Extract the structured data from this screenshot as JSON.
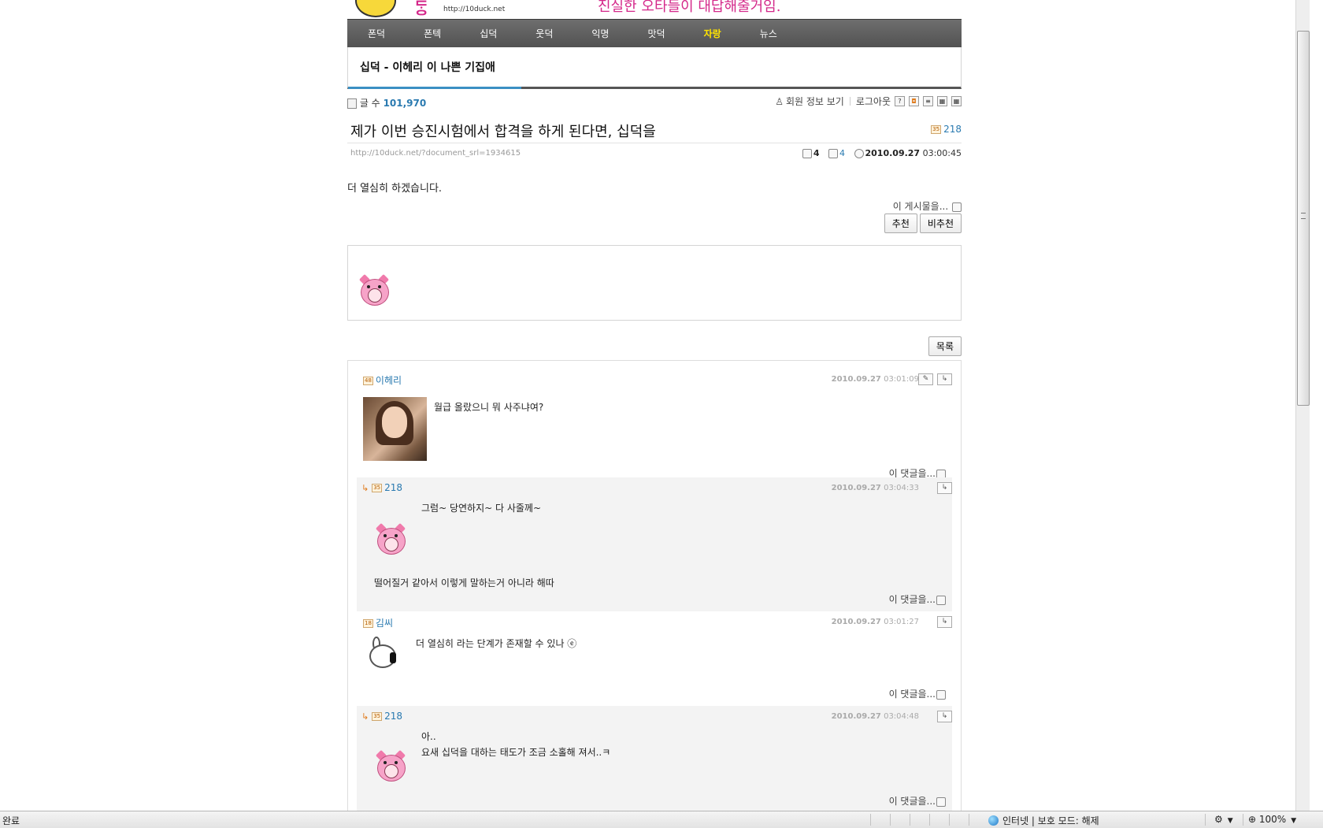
{
  "header": {
    "logo_fragment": "ᄃᆞᆼ",
    "logo_url": "http://10duck.net",
    "slogan": "진실한 오타들이 대답해줄거임."
  },
  "nav": [
    "폰덕",
    "폰텍",
    "십덕",
    "웃덕",
    "익명",
    "맛덕",
    "자랑",
    "뉴스"
  ],
  "nav_active_index": 6,
  "board_title": "십덕 - 이헤리 이 나쁜 기집애",
  "info": {
    "count_label": "글 수",
    "count_value": "101,970",
    "member_info": "회원 정보 보기",
    "logout": "로그아웃"
  },
  "document": {
    "title": "제가 이번 승진시험에서 합격을 하게 된다면, 십덕을",
    "author": "218",
    "url": "http://10duck.net/?document_srl=1934615",
    "comment_count": "4",
    "read_count": "4",
    "date": "2010.09.27",
    "time": "03:00:45",
    "content": "더 열심히 하겠습니다.",
    "this_post": "이 게시물을...",
    "recommend": "추천",
    "not_recommend": "비추천",
    "list_button": "목록"
  },
  "comments": [
    {
      "author": "이헤리",
      "date": "2010.09.27",
      "time": "03:01:09",
      "lines": [
        "월급 올랐으니 뭐 사주냐여?"
      ],
      "more": "이 댓글을..."
    },
    {
      "author": "218",
      "date": "2010.09.27",
      "time": "03:04:33",
      "lines": [
        "그럼~ 당연하지~ 다 사줄께~",
        "떨어질거 같아서 이렇게 말하는거 아니라 해따"
      ],
      "more": "이 댓글을..."
    },
    {
      "author": "김씨",
      "date": "2010.09.27",
      "time": "03:01:27",
      "lines": [
        "더 열심히 라는 단계가 존재할 수 있나 ⓔ"
      ],
      "more": "이 댓글을..."
    },
    {
      "author": "218",
      "date": "2010.09.27",
      "time": "03:04:48",
      "lines": [
        "아..",
        "요새 십덕을 대하는 태도가 조금 소홀해 져서..ㅋ"
      ],
      "more": "이 댓글을..."
    }
  ],
  "statusbar": {
    "left": "완료",
    "zone": "인터넷 | 보호 모드: 해제",
    "zoom": "100%"
  },
  "colors": {
    "nav_bg": "#5e5e5e",
    "nav_active": "#ffe400",
    "link_blue": "#2a7ab0",
    "reply_bg": "#f3f3f3"
  }
}
